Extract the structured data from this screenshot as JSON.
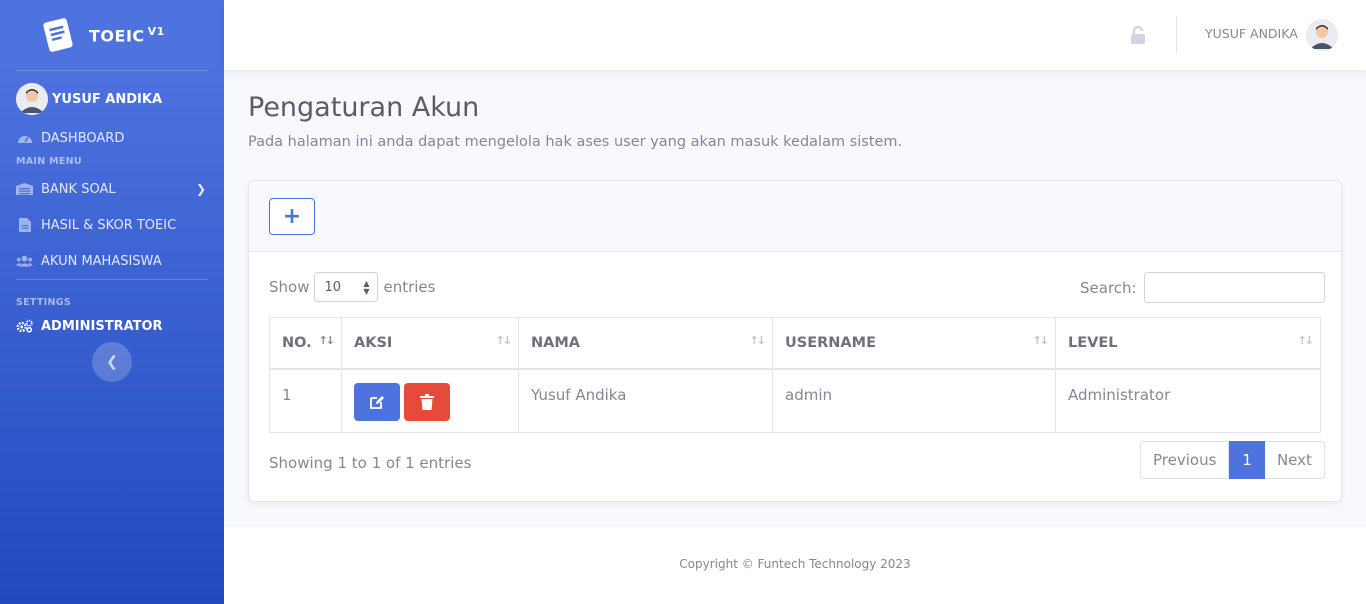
{
  "brand": {
    "name": "TOEIC",
    "version": "V1"
  },
  "sidebar": {
    "user": "YUSUF ANDIKA",
    "dashboard": "DASHBOARD",
    "main_menu_heading": "MAIN MENU",
    "items": [
      {
        "label": "BANK SOAL",
        "icon": "warehouse-icon"
      },
      {
        "label": "HASIL & SKOR TOEIC",
        "icon": "file-icon"
      },
      {
        "label": "AKUN MAHASISWA",
        "icon": "users-icon"
      }
    ],
    "settings_heading": "SETTINGS",
    "settings_item": "ADMINISTRATOR"
  },
  "topbar": {
    "user": "YUSUF ANDIKA"
  },
  "page": {
    "title": "Pengaturan Akun",
    "description": "Pada halaman ini anda dapat mengelola hak ases user yang akan masuk kedalam sistem."
  },
  "table_controls": {
    "show_label": "Show",
    "entries_label": "entries",
    "page_length": "10",
    "search_label": "Search:"
  },
  "table": {
    "columns": [
      "NO.",
      "AKSI",
      "NAMA",
      "USERNAME",
      "LEVEL"
    ],
    "rows": [
      {
        "no": "1",
        "nama": "Yusuf Andika",
        "username": "admin",
        "level": "Administrator"
      }
    ]
  },
  "pagination": {
    "info": "Showing 1 to 1 of 1 entries",
    "previous": "Previous",
    "current": "1",
    "next": "Next"
  },
  "footer": {
    "copyright": "Copyright © Funtech Technology 2023"
  },
  "colors": {
    "primary": "#4e73df",
    "danger": "#e74a3b",
    "sidebar_start": "#4e73df",
    "sidebar_end": "#224abe"
  }
}
